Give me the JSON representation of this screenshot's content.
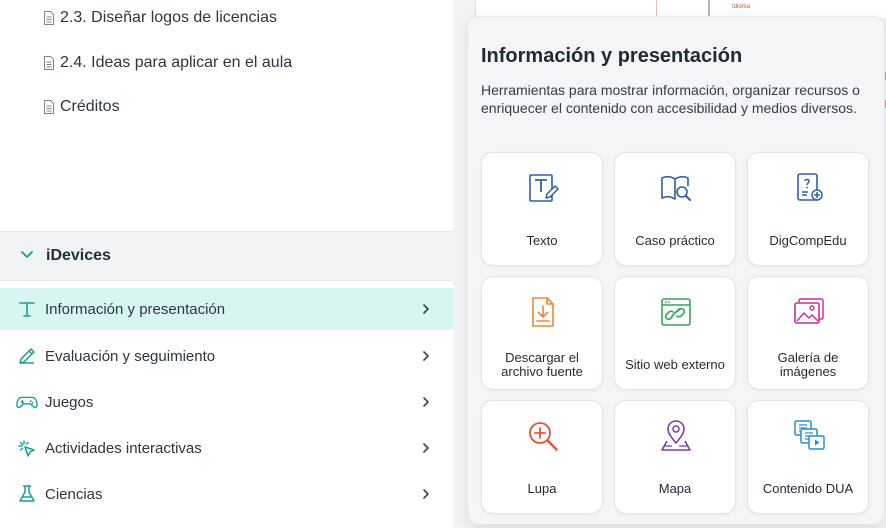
{
  "sidebar": {
    "pages": [
      {
        "label": "2.3. Diseñar logos de licencias"
      },
      {
        "label": "2.4. Ideas para aplicar en el aula"
      },
      {
        "label": "Créditos"
      }
    ],
    "group": {
      "label": "iDevices"
    },
    "categories": [
      {
        "label": "Información y presentación",
        "icon": "text-t-icon",
        "active": true
      },
      {
        "label": "Evaluación y seguimiento",
        "icon": "pencil-icon",
        "active": false
      },
      {
        "label": "Juegos",
        "icon": "gamepad-icon",
        "active": false
      },
      {
        "label": "Actividades interactivas",
        "icon": "tap-sparkle-icon",
        "active": false
      },
      {
        "label": "Ciencias",
        "icon": "flask-icon",
        "active": false
      }
    ]
  },
  "background": {
    "doc_label": "Idioma"
  },
  "panel": {
    "title": "Información y presentación",
    "description": "Herramientas para mostrar información, organizar recursos o enriquecer el contenido con accesibilidad y medios diversos.",
    "cards": [
      {
        "label": "Texto",
        "icon": "text-edit-icon",
        "color": "#2f5fa8"
      },
      {
        "label": "Caso práctico",
        "icon": "book-search-icon",
        "color": "#2f5fa8"
      },
      {
        "label": "DigCompEdu",
        "icon": "doc-question-icon",
        "color": "#2f5fa8"
      },
      {
        "label": "Descargar el archivo fuente",
        "icon": "download-file-icon",
        "color": "#e8893a"
      },
      {
        "label": "Sitio web externo",
        "icon": "web-link-icon",
        "color": "#3aa35a"
      },
      {
        "label": "Galería de imágenes",
        "icon": "image-gallery-icon",
        "color": "#c2368f"
      },
      {
        "label": "Lupa",
        "icon": "magnifier-plus-icon",
        "color": "#e0533a"
      },
      {
        "label": "Mapa",
        "icon": "map-pin-icon",
        "color": "#7a3bb0"
      },
      {
        "label": "Contenido DUA",
        "icon": "dua-content-icon",
        "color": "#2a8fc6"
      }
    ]
  },
  "colors": {
    "accent": "#1a9e8f",
    "active_bg": "#d8f6f1",
    "panel_bg": "#f4f5f7"
  }
}
